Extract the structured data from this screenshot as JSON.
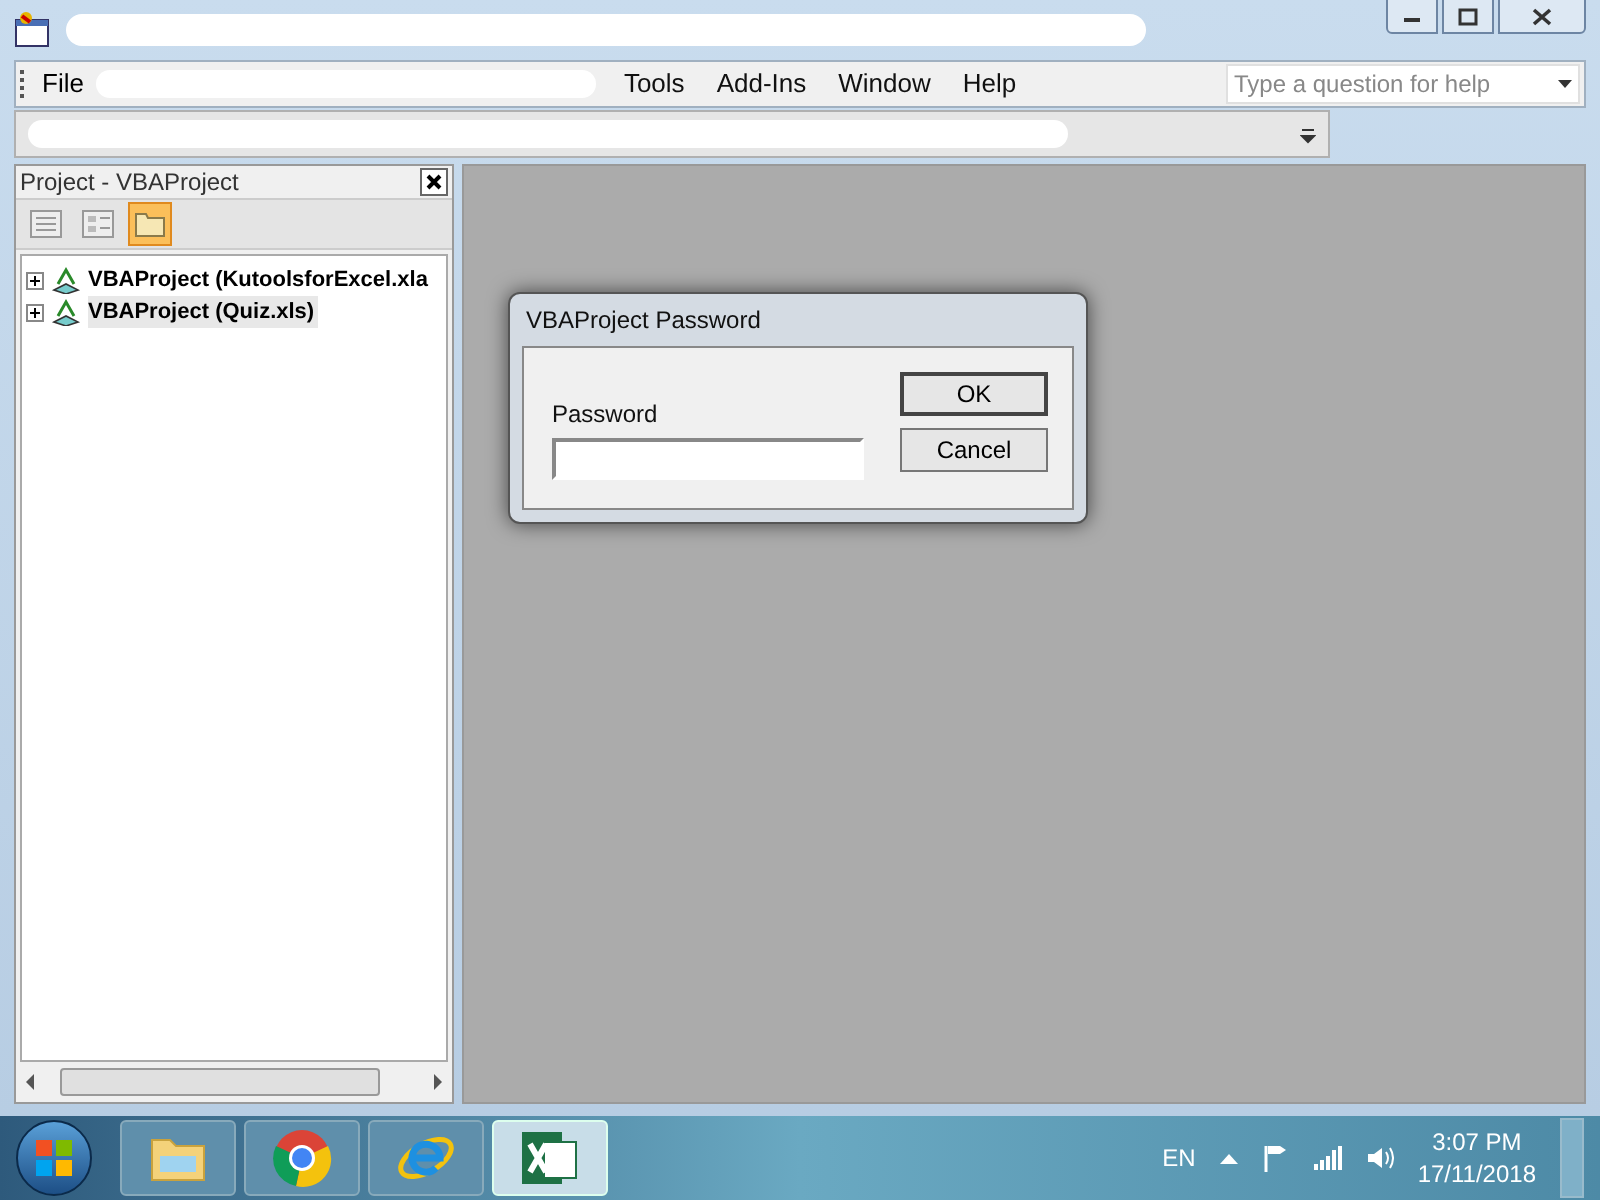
{
  "menu_bar": {
    "items": [
      {
        "label": "File"
      },
      {
        "label": "Tools"
      },
      {
        "label": "Add-Ins"
      },
      {
        "label": "Window"
      },
      {
        "label": "Help"
      }
    ],
    "help_field": {
      "placeholder": "Type a question for help"
    }
  },
  "project_panel": {
    "title": "Project - VBAProject",
    "toolbar": [
      {
        "kind": "view-code",
        "selected": false
      },
      {
        "kind": "view-object",
        "selected": false
      },
      {
        "kind": "toggle-folders",
        "selected": true
      }
    ],
    "tree": [
      {
        "label": "VBAProject (KutoolsforExcel.xla",
        "selected": false,
        "expanded": false
      },
      {
        "label": "VBAProject (Quiz.xls)",
        "selected": true,
        "expanded": false
      }
    ]
  },
  "dialog": {
    "title": "VBAProject Password",
    "field_label": "Password",
    "buttons": [
      {
        "label": "OK",
        "default": true
      },
      {
        "label": "Cancel",
        "default": false
      }
    ]
  },
  "taskbar": {
    "apps": [
      {
        "kind": "folder",
        "active": false
      },
      {
        "kind": "chrome",
        "active": false
      },
      {
        "kind": "ie",
        "active": false
      },
      {
        "kind": "excel",
        "active": true
      }
    ],
    "language": "EN",
    "time": "3:07 PM",
    "date": "17/11/2018"
  }
}
